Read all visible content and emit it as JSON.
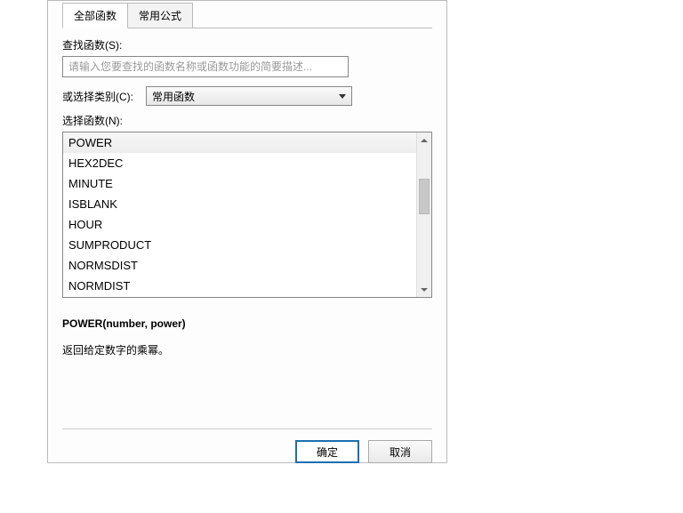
{
  "tabs": {
    "all_functions": "全部函数",
    "common_formulas": "常用公式"
  },
  "search": {
    "label": "查找函数(S):",
    "placeholder": "请输入您要查找的函数名称或函数功能的简要描述..."
  },
  "category": {
    "label": "或选择类别(C):",
    "selected": "常用函数"
  },
  "select_function": {
    "label": "选择函数(N):"
  },
  "functions": {
    "items": [
      "POWER",
      "HEX2DEC",
      "MINUTE",
      "ISBLANK",
      "HOUR",
      "SUMPRODUCT",
      "NORMSDIST",
      "NORMDIST"
    ]
  },
  "detail": {
    "signature": "POWER(number, power)",
    "description": "返回给定数字的乘幂。"
  },
  "buttons": {
    "ok": "确定",
    "cancel": "取消"
  }
}
